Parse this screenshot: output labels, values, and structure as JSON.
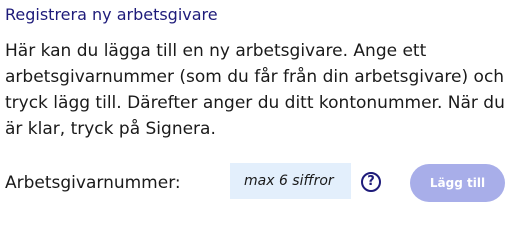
{
  "form": {
    "title": "Registrera ny arbetsgivare",
    "description": "Här kan du lägga till en ny arbetsgivare. Ange ett arbetsgivarnummer (som du får från din arbetsgivare) och tryck lägg till. Därefter anger du ditt kontonummer. När du är klar, tryck på Signera.",
    "employer_number_label": "Arbetsgivarnummer:",
    "employer_number_placeholder": "max 6 siffror",
    "employer_number_value": "",
    "help_icon": "question-circle-icon",
    "help_glyph": "?",
    "add_button_label": "Lägg till",
    "add_button_enabled": false
  },
  "colors": {
    "title": "#1e1b7a",
    "input_background": "#e3effc",
    "button_disabled": "#a8aee9",
    "help_icon": "#1e1b7a"
  }
}
